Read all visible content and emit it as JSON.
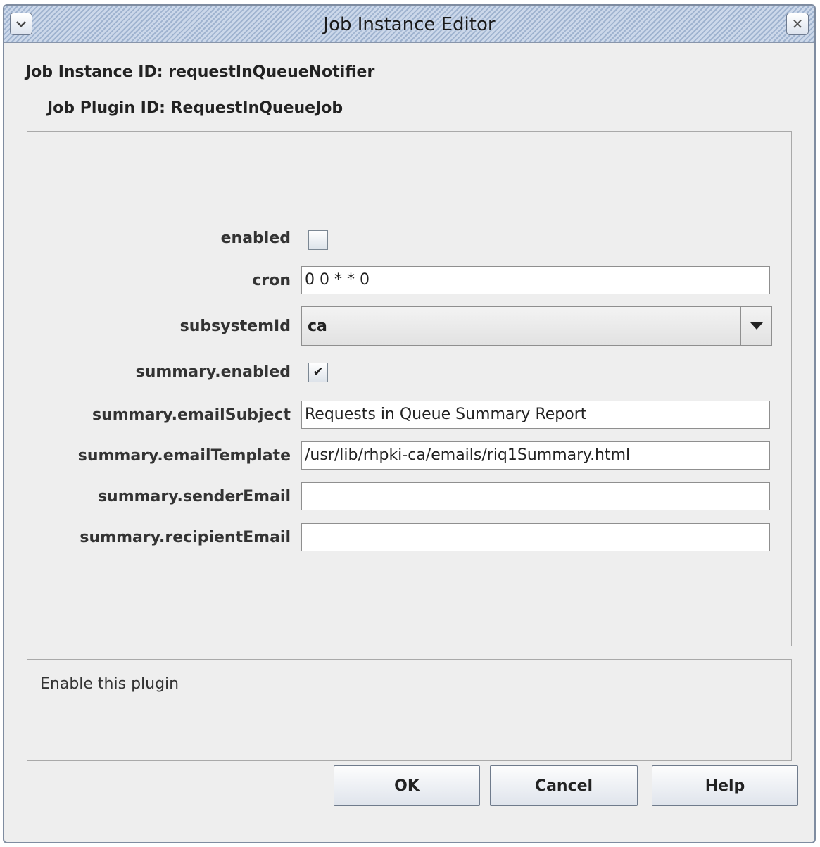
{
  "window": {
    "title": "Job Instance Editor"
  },
  "header": {
    "instance_label": "Job Instance ID:",
    "instance_value": "requestInQueueNotifier",
    "plugin_label": "Job Plugin ID:",
    "plugin_value": "RequestInQueueJob"
  },
  "fields": {
    "enabled": {
      "label": "enabled",
      "checked": false,
      "mark": ""
    },
    "cron": {
      "label": "cron",
      "value": "0 0 * * 0"
    },
    "subsystemId": {
      "label": "subsystemId",
      "value": "ca"
    },
    "summary_enabled": {
      "label": "summary.enabled",
      "checked": true,
      "mark": "✔"
    },
    "summary_emailSubject": {
      "label": "summary.emailSubject",
      "value": "Requests in Queue Summary Report"
    },
    "summary_emailTemplate": {
      "label": "summary.emailTemplate",
      "value": "/usr/lib/rhpki-ca/emails/riq1Summary.html"
    },
    "summary_senderEmail": {
      "label": "summary.senderEmail",
      "value": ""
    },
    "summary_recipientEmail": {
      "label": "summary.recipientEmail",
      "value": ""
    }
  },
  "description": {
    "text": "Enable this plugin"
  },
  "buttons": {
    "ok": "OK",
    "cancel": "Cancel",
    "help": "Help"
  },
  "icons": {
    "menu": "chevron-down-icon",
    "close": "close-icon",
    "dropdown": "triangle-down-icon"
  },
  "colors": {
    "title_stripe": "#9fb3cf",
    "title_bg": "#ccd8ea",
    "dialog_bg": "#eeeeee"
  }
}
